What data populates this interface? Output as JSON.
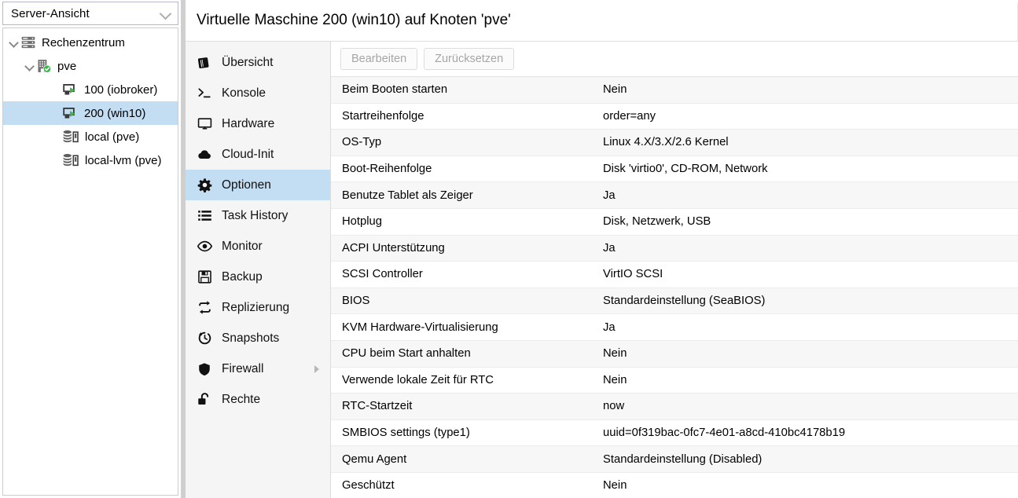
{
  "sidebar": {
    "view_selector": {
      "label": "Server-Ansicht",
      "icon": "chevron-down-icon"
    },
    "tree": [
      {
        "label": "Rechenzentrum",
        "icon": "datacenter-icon",
        "level": 0,
        "expanded": true,
        "selected": false
      },
      {
        "label": "pve",
        "icon": "node-online-icon",
        "level": 1,
        "expanded": true,
        "selected": false
      },
      {
        "label": "100 (iobroker)",
        "icon": "vm-running-icon",
        "level": 2,
        "expanded": false,
        "selected": false
      },
      {
        "label": "200 (win10)",
        "icon": "vm-running-icon",
        "level": 2,
        "expanded": false,
        "selected": true
      },
      {
        "label": "local (pve)",
        "icon": "storage-icon",
        "level": 2,
        "expanded": false,
        "selected": false
      },
      {
        "label": "local-lvm (pve)",
        "icon": "storage-icon",
        "level": 2,
        "expanded": false,
        "selected": false
      }
    ]
  },
  "header": {
    "title": "Virtuelle Maschine 200 (win10) auf Knoten 'pve'"
  },
  "nav": {
    "items": [
      {
        "label": "Übersicht",
        "icon": "book-icon",
        "active": false,
        "submenu": false
      },
      {
        "label": "Konsole",
        "icon": "terminal-icon",
        "active": false,
        "submenu": false
      },
      {
        "label": "Hardware",
        "icon": "monitor-icon",
        "active": false,
        "submenu": false
      },
      {
        "label": "Cloud-Init",
        "icon": "cloud-icon",
        "active": false,
        "submenu": false
      },
      {
        "label": "Optionen",
        "icon": "gear-icon",
        "active": true,
        "submenu": false
      },
      {
        "label": "Task History",
        "icon": "list-icon",
        "active": false,
        "submenu": false
      },
      {
        "label": "Monitor",
        "icon": "eye-icon",
        "active": false,
        "submenu": false
      },
      {
        "label": "Backup",
        "icon": "floppy-icon",
        "active": false,
        "submenu": false
      },
      {
        "label": "Replizierung",
        "icon": "replication-icon",
        "active": false,
        "submenu": false
      },
      {
        "label": "Snapshots",
        "icon": "history-icon",
        "active": false,
        "submenu": false
      },
      {
        "label": "Firewall",
        "icon": "shield-icon",
        "active": false,
        "submenu": true
      },
      {
        "label": "Rechte",
        "icon": "unlock-icon",
        "active": false,
        "submenu": false
      }
    ]
  },
  "toolbar": {
    "edit_label": "Bearbeiten",
    "reset_label": "Zurücksetzen",
    "edit_disabled": true,
    "reset_disabled": true
  },
  "options": {
    "rows": [
      {
        "key": "Beim Booten starten",
        "value": "Nein"
      },
      {
        "key": "Startreihenfolge",
        "value": "order=any"
      },
      {
        "key": "OS-Typ",
        "value": "Linux 4.X/3.X/2.6 Kernel"
      },
      {
        "key": "Boot-Reihenfolge",
        "value": "Disk 'virtio0', CD-ROM, Network"
      },
      {
        "key": "Benutze Tablet als Zeiger",
        "value": "Ja"
      },
      {
        "key": "Hotplug",
        "value": "Disk, Netzwerk, USB"
      },
      {
        "key": "ACPI Unterstützung",
        "value": "Ja"
      },
      {
        "key": "SCSI Controller",
        "value": "VirtIO SCSI"
      },
      {
        "key": "BIOS",
        "value": "Standardeinstellung (SeaBIOS)"
      },
      {
        "key": "KVM Hardware-Virtualisierung",
        "value": "Ja"
      },
      {
        "key": "CPU beim Start anhalten",
        "value": "Nein"
      },
      {
        "key": "Verwende lokale Zeit für RTC",
        "value": "Nein"
      },
      {
        "key": "RTC-Startzeit",
        "value": "now"
      },
      {
        "key": "SMBIOS settings (type1)",
        "value": "uuid=0f319bac-0fc7-4e01-a8cd-410bc4178b19"
      },
      {
        "key": "Qemu Agent",
        "value": "Standardeinstellung (Disabled)"
      },
      {
        "key": "Geschützt",
        "value": "Nein"
      }
    ]
  },
  "colors": {
    "selection": "#c3ddf2",
    "running_green": "#3cb54a",
    "nav_bg": "#f5f5f5",
    "row_alt": "#f7f7f7"
  }
}
